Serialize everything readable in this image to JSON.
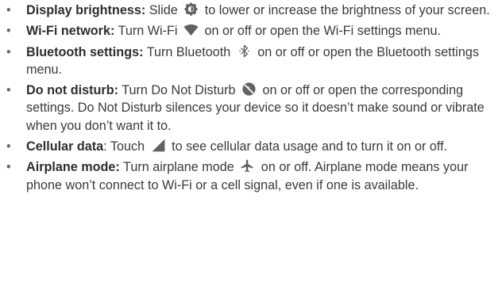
{
  "colors": {
    "text": "#3a3a3a",
    "icon": "#616161",
    "bullet": "#6a6a6a"
  },
  "bullet_char": "•",
  "items": [
    {
      "key": "display-brightness",
      "runs": [
        {
          "t": "bold",
          "v": "Display brightness:"
        },
        {
          "t": "text",
          "v": " Slide "
        },
        {
          "t": "icon",
          "name": "brightness-icon"
        },
        {
          "t": "text",
          "v": " to lower or increase the brightness of your screen."
        }
      ]
    },
    {
      "key": "wifi-network",
      "runs": [
        {
          "t": "bold",
          "v": "Wi-Fi network:"
        },
        {
          "t": "text",
          "v": " Turn Wi-Fi "
        },
        {
          "t": "icon",
          "name": "wifi-icon"
        },
        {
          "t": "text",
          "v": " on or off or open the Wi-Fi settings menu."
        }
      ]
    },
    {
      "key": "bluetooth-settings",
      "runs": [
        {
          "t": "bold",
          "v": "Bluetooth settings:"
        },
        {
          "t": "text",
          "v": " Turn Bluetooth "
        },
        {
          "t": "icon",
          "name": "bluetooth-icon"
        },
        {
          "t": "text",
          "v": " on or off or open the Bluetooth settings menu."
        }
      ]
    },
    {
      "key": "do-not-disturb",
      "runs": [
        {
          "t": "bold",
          "v": "Do not disturb:"
        },
        {
          "t": "text",
          "v": " Turn Do Not Disturb "
        },
        {
          "t": "icon",
          "name": "do-not-disturb-icon"
        },
        {
          "t": "text",
          "v": " on or off or open the corresponding settings. Do Not Disturb silences your device so it doesn’t make sound or vibrate when you don’t want it to."
        }
      ]
    },
    {
      "key": "cellular-data",
      "runs": [
        {
          "t": "bold",
          "v": "Cellular data"
        },
        {
          "t": "text",
          "v": ": Touch "
        },
        {
          "t": "icon",
          "name": "cellular-signal-icon"
        },
        {
          "t": "text",
          "v": " to see cellular data usage and to turn it on or off."
        }
      ]
    },
    {
      "key": "airplane-mode",
      "runs": [
        {
          "t": "bold",
          "v": "Airplane mode:"
        },
        {
          "t": "text",
          "v": " Turn airplane mode "
        },
        {
          "t": "icon",
          "name": "airplane-icon"
        },
        {
          "t": "text",
          "v": " on or off. Airplane mode means your phone won’t connect to Wi-Fi or a cell signal, even if one is available."
        }
      ]
    }
  ]
}
